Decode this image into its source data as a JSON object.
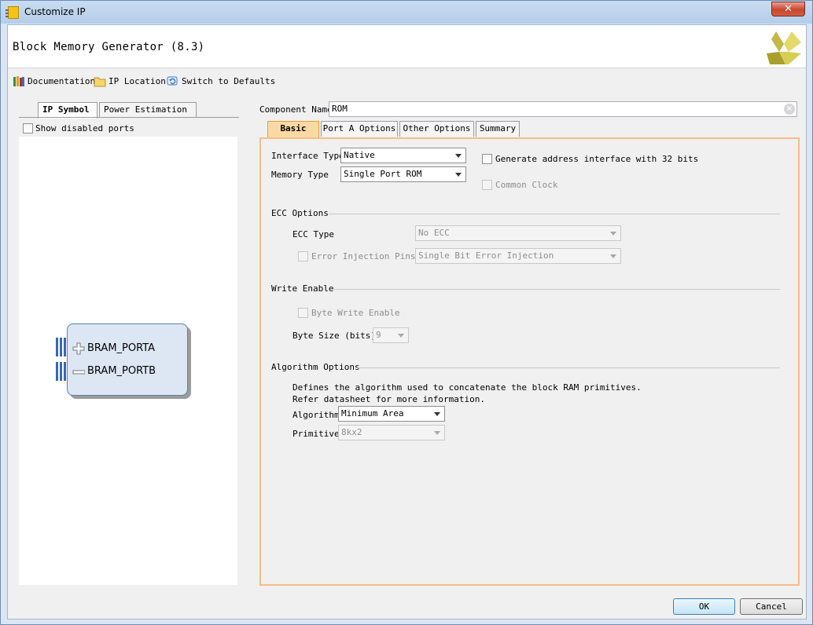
{
  "window": {
    "title": "Customize IP",
    "close_glyph": "✕"
  },
  "header": {
    "title": "Block Memory Generator (8.3)",
    "logo": "xilinx-logo"
  },
  "toolbar": {
    "documentation": "Documentation",
    "ip_location": "IP Location",
    "switch_defaults": "Switch to Defaults"
  },
  "left_panel": {
    "tabs": [
      {
        "label": "IP Symbol",
        "active": true
      },
      {
        "label": "Power Estimation",
        "active": false
      }
    ],
    "show_disabled_ports": {
      "label": "Show disabled ports",
      "checked": false
    },
    "symbol": {
      "ports": [
        {
          "sign": "+",
          "name": "BRAM_PORTA"
        },
        {
          "sign": "−",
          "name": "BRAM_PORTB"
        }
      ]
    }
  },
  "right_panel": {
    "component_name": {
      "label": "Component Name",
      "value": "ROM"
    },
    "tabs": [
      {
        "label": "Basic",
        "active": true
      },
      {
        "label": "Port A Options",
        "active": false
      },
      {
        "label": "Other Options",
        "active": false
      },
      {
        "label": "Summary",
        "active": false
      }
    ],
    "basic": {
      "interface_type": {
        "label": "Interface Type",
        "value": "Native"
      },
      "memory_type": {
        "label": "Memory Type",
        "value": "Single Port ROM"
      },
      "gen_addr_32": {
        "label": "Generate address interface with 32 bits",
        "checked": false
      },
      "common_clock": {
        "label": "Common Clock",
        "checked": false,
        "disabled": true
      },
      "ecc": {
        "title": "ECC Options",
        "ecc_type": {
          "label": "ECC Type",
          "value": "No ECC"
        },
        "error_injection": {
          "label": "Error Injection Pins",
          "value": "Single Bit Error Injection"
        }
      },
      "write_enable": {
        "title": "Write Enable",
        "byte_write_enable": {
          "label": "Byte Write Enable",
          "checked": false
        },
        "byte_size": {
          "label": "Byte Size (bits)",
          "value": "9"
        }
      },
      "algorithm": {
        "title": "Algorithm Options",
        "desc_line1": "Defines the algorithm used to concatenate the block RAM primitives.",
        "desc_line2": "Refer datasheet for more information.",
        "algorithm": {
          "label": "Algorithm",
          "value": "Minimum Area"
        },
        "primitive": {
          "label": "Primitive",
          "value": "8kx2"
        }
      }
    }
  },
  "footer": {
    "ok": "OK",
    "cancel": "Cancel"
  }
}
